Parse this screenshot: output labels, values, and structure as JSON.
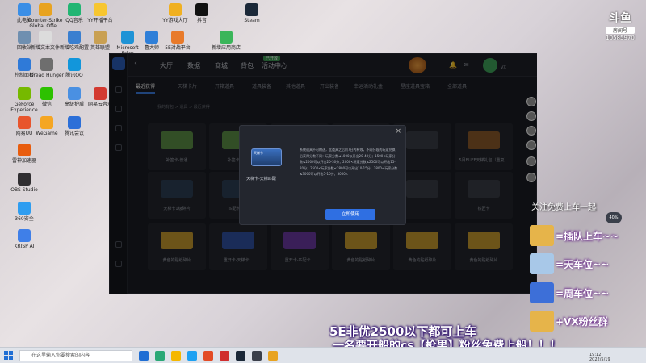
{
  "desktop_icons": [
    {
      "label": "此电脑",
      "color": "#3a8ee6"
    },
    {
      "label": "Counter-Strike Global Offe...",
      "color": "#e8a320"
    },
    {
      "label": "QQ音乐",
      "color": "#22b573"
    },
    {
      "label": "YY开播平台",
      "color": "#f7c630"
    },
    {
      "label": "YY游戏大厅",
      "color": "#f0b020"
    },
    {
      "label": "抖音",
      "color": "#111111"
    },
    {
      "label": "Steam",
      "color": "#1b2838"
    },
    {
      "label": "回收站",
      "color": "#6f8fb0"
    },
    {
      "label": "新增文本文件",
      "color": "#dcdcdc"
    },
    {
      "label": "新增吃鸡配置",
      "color": "#3a7fd0"
    },
    {
      "label": "英雄联盟",
      "color": "#c9a052"
    },
    {
      "label": "Microsoft Edge",
      "color": "#1f93d6"
    },
    {
      "label": "鲁大师",
      "color": "#2f7fd8"
    },
    {
      "label": "5E对战平台",
      "color": "#e87a2a"
    },
    {
      "label": "新增应用商店",
      "color": "#3bb55a"
    },
    {
      "label": "控制面板",
      "color": "#2f7ad8"
    },
    {
      "label": "Dread Hunger",
      "color": "#6e6e6e"
    },
    {
      "label": "腾讯QQ",
      "color": "#1296db"
    },
    {
      "label": "GeForce Experience",
      "color": "#76b900"
    },
    {
      "label": "微信",
      "color": "#2dc100"
    },
    {
      "label": "高级护盾",
      "color": "#4a90e2"
    },
    {
      "label": "网易云音乐",
      "color": "#d33a31"
    },
    {
      "label": "网易UU",
      "color": "#e8552d"
    },
    {
      "label": "WeGame",
      "color": "#f5a623"
    },
    {
      "label": "腾讯会议",
      "color": "#2c6fd8"
    },
    {
      "label": "雷神加速器",
      "color": "#e85c0d"
    },
    {
      "label": "OBS Studio",
      "color": "#302e31"
    },
    {
      "label": "360安全",
      "color": "#2e9df0"
    },
    {
      "label": "KRISP AI",
      "color": "#3f7fe8"
    }
  ],
  "app": {
    "nav": [
      "大厅",
      "数据",
      "商城",
      "背包",
      "活动中心"
    ],
    "nav_badge": "已开放",
    "profile_status": "VX",
    "sub_tabs": [
      "最近获得",
      "天梯卡片",
      "开箱道具",
      "道具装备",
      "其他道具",
      "开出装备",
      "幸运活动礼盒",
      "星座道具宝箱",
      "全部道具"
    ],
    "breadcrumb": "我的背包 > 道具 > 最近获得",
    "cards": [
      {
        "label": "补签卡-普通",
        "color": "#5b8f45"
      },
      {
        "label": "补签卡-普通",
        "color": "#5b8f45"
      },
      {
        "label": "",
        "color": "#3a3d45"
      },
      {
        "label": "",
        "color": "#3a3d45"
      },
      {
        "label": "",
        "color": "#3a3d45"
      },
      {
        "label": "",
        "color": "#6b3a5a"
      },
      {
        "label": "5月BUFF天梯礼包（重复）",
        "color": "#8a5a2a"
      },
      {
        "label": "天梯卡1级碎片",
        "color": "#2c3f55"
      },
      {
        "label": "匹配卡碎片",
        "color": "#2c3f55"
      },
      {
        "label": "",
        "color": "#3a3d45"
      },
      {
        "label": "",
        "color": "#3a3d45"
      },
      {
        "label": "",
        "color": "#3a3d45"
      },
      {
        "label": "铁匠卡",
        "color": "#3a3d45"
      },
      {
        "label": "黄色的贴纸碎片",
        "color": "#c59a2e"
      },
      {
        "label": "重开卡-天梯卡...",
        "color": "#3050a0"
      },
      {
        "label": "重开卡-匹配卡...",
        "color": "#6a3aa0"
      },
      {
        "label": "黄色的贴纸碎片",
        "color": "#c59a2e"
      },
      {
        "label": "黄色的贴纸碎片",
        "color": "#c59a2e"
      },
      {
        "label": "黄色的贴纸碎片",
        "color": "#c59a2e"
      },
      {
        "label": "黄色的贴纸碎片",
        "color": "#c59a2e"
      },
      {
        "label": "黄色的贴纸碎片",
        "color": "#c59a2e"
      }
    ]
  },
  "modal": {
    "card_text": "天梯卡",
    "card_name": "天梯卡-天梯匹配",
    "description": "系统道具不可赠送，此道具之后前7日内有效，不同分段的玩家兑换后获得分数不同：玩家分数≤1000以开出20-40分；1500<玩家分数≤2000可以开出20-30分；2000<玩家分数≤2500可以开出15-20分；2500<玩家分数≤2800可以开出10-15分；2800<玩家分数≤3000可以开出5-10分；3000<",
    "button": "立即使用",
    "close": "×"
  },
  "stream": {
    "platform": "斗鱼",
    "room_label": "房间号",
    "room_number": "10585970",
    "promo_title": "关注免费上车一起",
    "promos": [
      {
        "text": "=插队上车~~",
        "color": "#e6b44a"
      },
      {
        "text": "=天车位~~",
        "color": "#a8c8e8"
      },
      {
        "text": "=周车位~~",
        "color": "#3d6fd8"
      },
      {
        "text": "+VX粉丝群",
        "color": "#e6b44a"
      }
    ],
    "bottom_line1": "5E非优2500以下都可上车",
    "bottom_line2": "一名要开船的cs【枪男】粉丝免费上船！！！",
    "speed": "40%"
  },
  "taskbar": {
    "search_placeholder": "在这里输入你要搜索的内容",
    "apps": [
      "#1f6ed4",
      "#2aa876",
      "#f5b700",
      "#1da1f2",
      "#e34c26",
      "#d02e2e",
      "#1b2838",
      "#3a3f4a",
      "#e8a320"
    ],
    "time": "19:12",
    "date": "2022/5/19"
  }
}
